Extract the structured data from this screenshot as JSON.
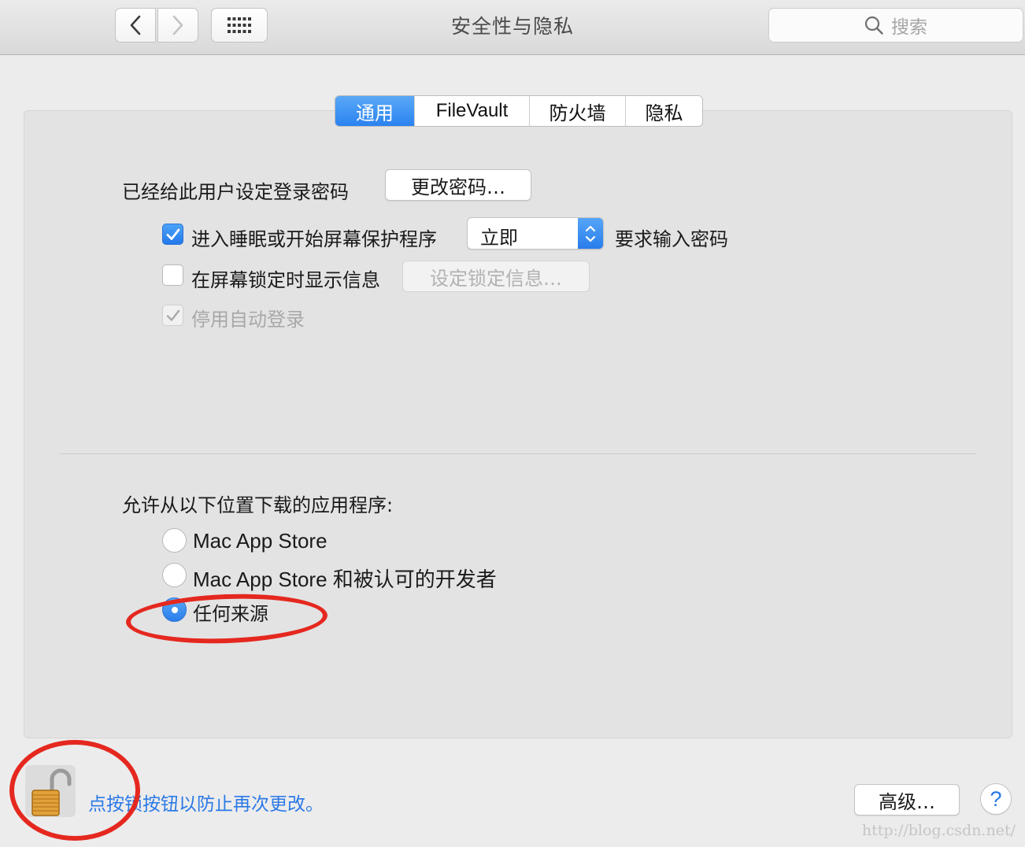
{
  "window": {
    "title": "安全性与隐私"
  },
  "toolbar": {
    "search_placeholder": "搜索"
  },
  "tabs": [
    {
      "label": "通用",
      "active": true
    },
    {
      "label": "FileVault",
      "active": false
    },
    {
      "label": "防火墙",
      "active": false
    },
    {
      "label": "隐私",
      "active": false
    }
  ],
  "general": {
    "password_set_label": "已经给此用户设定登录密码",
    "change_password_button": "更改密码…",
    "require_password": {
      "checked": true,
      "label": "进入睡眠或开始屏幕保护程序",
      "delay_value": "立即",
      "suffix": "要求输入密码"
    },
    "show_message": {
      "checked": false,
      "label": "在屏幕锁定时显示信息",
      "button": "设定锁定信息…"
    },
    "disable_auto_login": {
      "checked": true,
      "disabled": true,
      "label": "停用自动登录"
    }
  },
  "downloads": {
    "heading": "允许从以下位置下载的应用程序:",
    "options": [
      {
        "label": "Mac App Store",
        "selected": false
      },
      {
        "label": "Mac App Store 和被认可的开发者",
        "selected": false
      },
      {
        "label": "任何来源",
        "selected": true
      }
    ]
  },
  "footer": {
    "lock_hint": "点按锁按钮以防止再次更改。",
    "advanced_button": "高级…",
    "help_symbol": "?"
  },
  "watermark": "http://blog.csdn.net/",
  "colors": {
    "accent": "#2a82f0",
    "annotation": "#e5281f",
    "link": "#2b79e6"
  }
}
